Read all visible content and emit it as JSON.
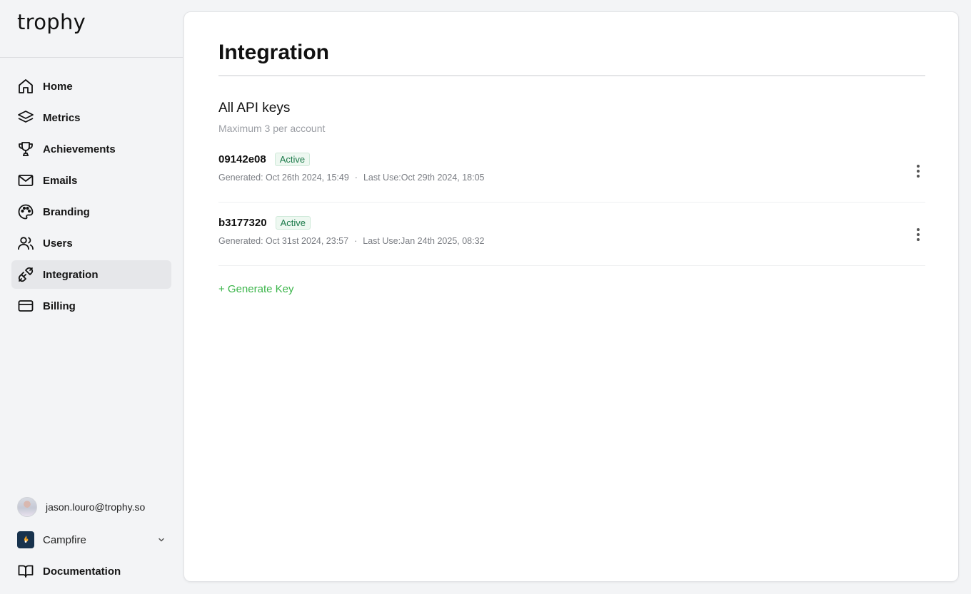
{
  "app": {
    "brand": "trophy"
  },
  "sidebar": {
    "items": [
      {
        "label": "Home",
        "icon": "home-icon"
      },
      {
        "label": "Metrics",
        "icon": "layers-icon"
      },
      {
        "label": "Achievements",
        "icon": "trophy-icon"
      },
      {
        "label": "Emails",
        "icon": "mail-icon"
      },
      {
        "label": "Branding",
        "icon": "palette-icon"
      },
      {
        "label": "Users",
        "icon": "users-icon"
      },
      {
        "label": "Integration",
        "icon": "plug-icon",
        "active": true
      },
      {
        "label": "Billing",
        "icon": "credit-card-icon"
      }
    ],
    "user_email": "jason.louro@trophy.so",
    "org_name": "Campfire",
    "docs_label": "Documentation"
  },
  "main": {
    "title": "Integration",
    "section_title": "All API keys",
    "section_subtitle": "Maximum 3 per account",
    "keys": [
      {
        "id": "09142e08",
        "status": "Active",
        "generated": "Generated: Oct 26th 2024, 15:49",
        "last_use": "Last Use:Oct 29th 2024, 18:05"
      },
      {
        "id": "b3177320",
        "status": "Active",
        "generated": "Generated: Oct 31st 2024, 23:57",
        "last_use": "Last Use:Jan 24th 2025, 08:32"
      }
    ],
    "separator": "·",
    "generate_label": "+ Generate Key"
  },
  "colors": {
    "accent_green": "#3bb54a",
    "badge_text": "#1c7a4a",
    "active_nav_bg": "#e6e7ea",
    "app_bg": "#f3f4f6"
  }
}
